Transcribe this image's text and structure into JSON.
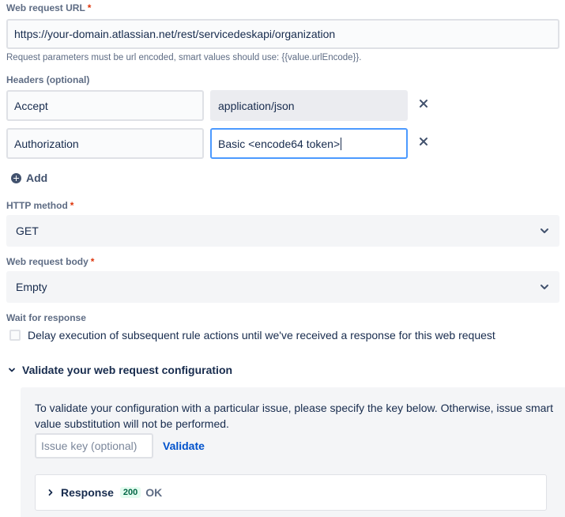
{
  "url_field": {
    "label": "Web request URL",
    "required_mark": "*",
    "value": "https://your-domain.atlassian.net/rest/servicedeskapi/organization",
    "helper": "Request parameters must be url encoded, smart values should use: {{value.urlEncode}}."
  },
  "headers": {
    "label": "Headers (optional)",
    "rows": [
      {
        "key": "Accept",
        "value": "application/json"
      },
      {
        "key": "Authorization",
        "value": "Basic <encode64 token>"
      }
    ],
    "add_label": "Add"
  },
  "http_method": {
    "label": "HTTP method",
    "required_mark": "*",
    "selected": "GET"
  },
  "request_body": {
    "label": "Web request body",
    "required_mark": "*",
    "selected": "Empty"
  },
  "wait": {
    "label": "Wait for response",
    "checkbox_label": "Delay execution of subsequent rule actions until we've received a response for this web request",
    "checked": false
  },
  "validate": {
    "title": "Validate your web request configuration",
    "description": "To validate your configuration with a particular issue, please specify the key below. Otherwise, issue smart value substitution will not be performed.",
    "issue_placeholder": "Issue key (optional)",
    "validate_label": "Validate",
    "response": {
      "title": "Response",
      "status_code": "200",
      "status_text": "OK"
    }
  },
  "colors": {
    "required": "#de350b",
    "link": "#0052cc",
    "focus": "#4c9aff",
    "success_bg": "#e3fcef",
    "success_text": "#006644"
  }
}
